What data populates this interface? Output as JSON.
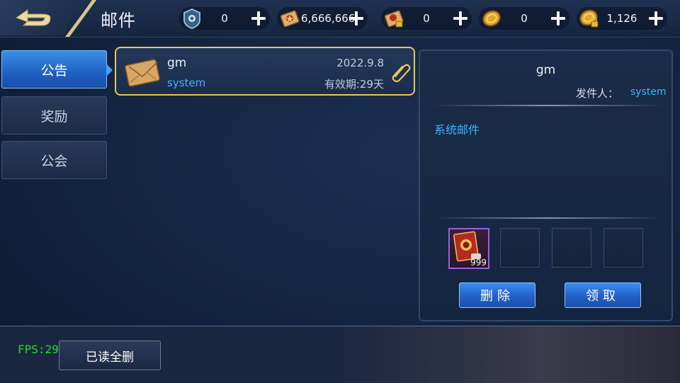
{
  "header": {
    "title": "邮件",
    "resources": [
      {
        "icon": "badge-token-icon",
        "value": "0"
      },
      {
        "icon": "red-scroll-icon",
        "value": "6,666,666"
      },
      {
        "icon": "locked-scroll-icon",
        "value": "0"
      },
      {
        "icon": "gold-coin-icon",
        "value": "0"
      },
      {
        "icon": "locked-gold-coin-icon",
        "value": "1,126"
      }
    ]
  },
  "tabs": [
    {
      "label": "公告",
      "active": true
    },
    {
      "label": "奖励",
      "active": false
    },
    {
      "label": "公会",
      "active": false
    }
  ],
  "mail_list": [
    {
      "name": "gm",
      "sender": "system",
      "date": "2022.9.8",
      "expiry": "有效期:29天",
      "has_attachment": true
    }
  ],
  "detail": {
    "name": "gm",
    "from_label": "发件人：",
    "from_value": "system",
    "body": "系统邮件",
    "attachments": [
      {
        "icon": "red-book-item-icon",
        "count": "999"
      },
      {
        "icon": "",
        "count": ""
      },
      {
        "icon": "",
        "count": ""
      },
      {
        "icon": "",
        "count": ""
      }
    ],
    "delete_label": "删除",
    "claim_label": "领取"
  },
  "footer": {
    "fps": "FPS:29",
    "read_all_delete": "已读全删"
  },
  "colors": {
    "accent_blue": "#3fb4ff",
    "selected_border": "#e8c65a",
    "fps_green": "#22dd22"
  }
}
